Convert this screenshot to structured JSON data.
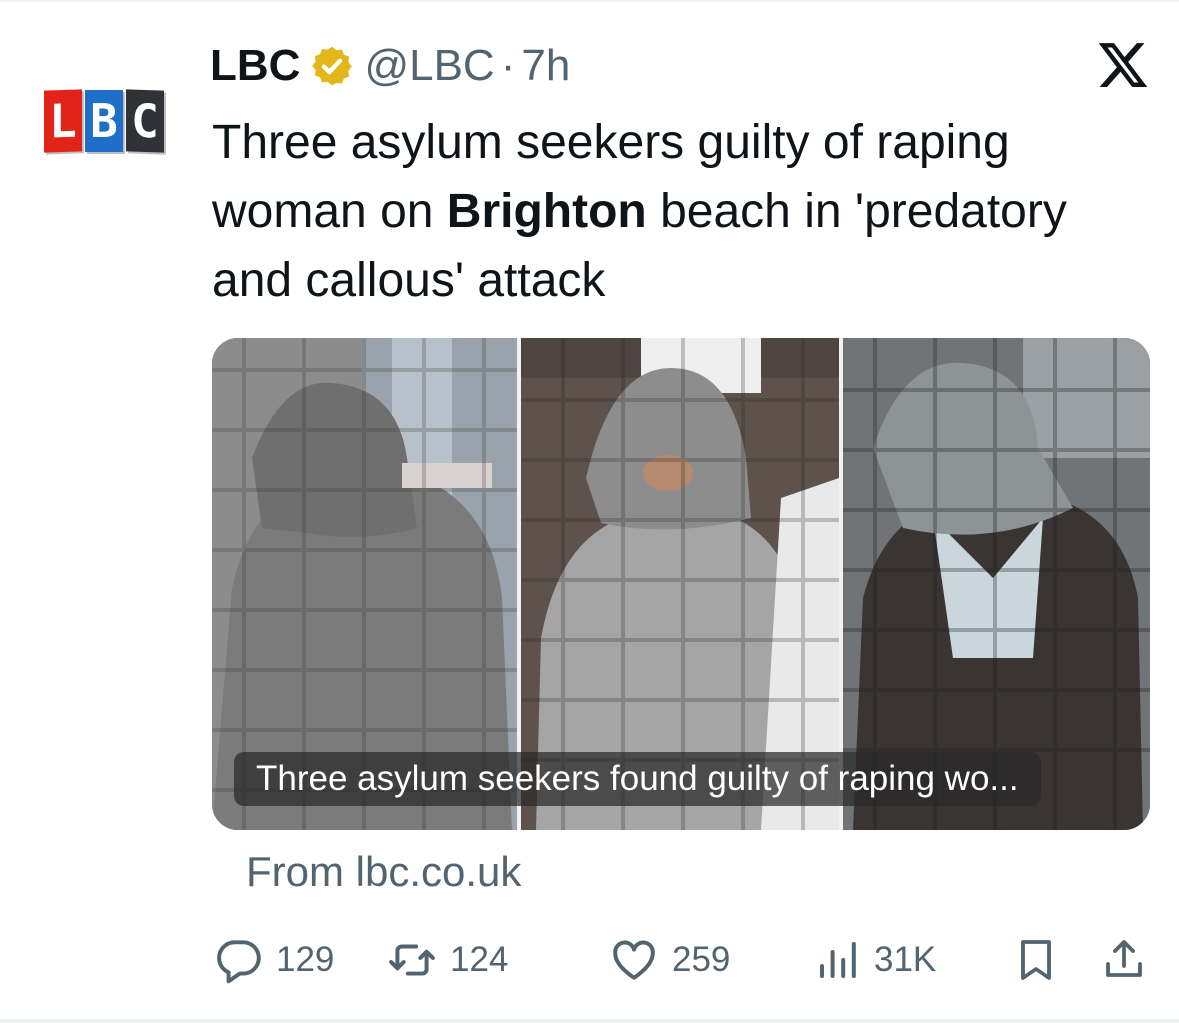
{
  "tweet": {
    "avatar_letters": [
      "L",
      "B",
      "C"
    ],
    "display_name": "LBC",
    "handle": "@LBC",
    "separator": "·",
    "time": "7h",
    "text_part1": "Three asylum seekers guilty of raping woman on ",
    "text_bold": "Brighton",
    "text_part2": " beach in 'predatory and callous' attack"
  },
  "card": {
    "caption": "Three asylum seekers found guilty of raping wo...",
    "source": "From lbc.co.uk"
  },
  "actions": {
    "reply_count": "129",
    "retweet_count": "124",
    "like_count": "259",
    "views_count": "31K"
  },
  "icons": {
    "verified": "verified-badge-icon",
    "x_logo": "x-logo-icon",
    "reply": "reply-icon",
    "retweet": "retweet-icon",
    "like": "heart-icon",
    "views": "views-icon",
    "bookmark": "bookmark-icon",
    "share": "share-icon"
  },
  "colors": {
    "verified_gold": "#e2b719",
    "secondary_text": "#536471",
    "logo_red": "#e2231a",
    "logo_blue": "#1d6fc9",
    "logo_dark": "#2f3338"
  }
}
